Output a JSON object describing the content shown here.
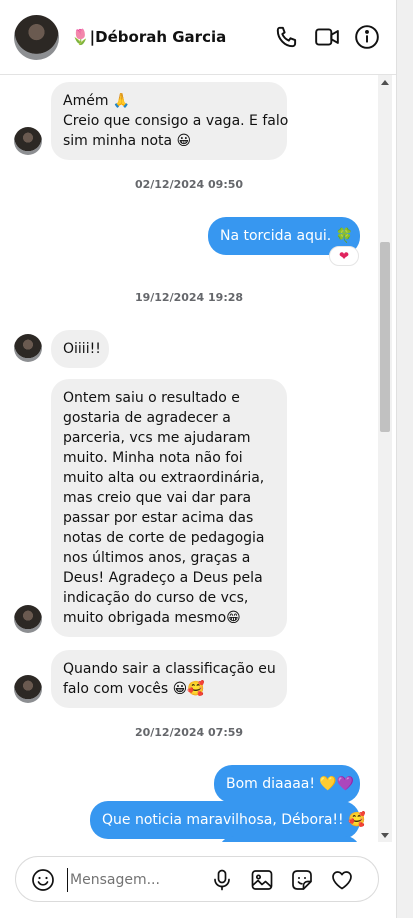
{
  "header": {
    "contact_name": "🌷|Déborah Garcia",
    "icons": [
      "phone-icon",
      "video-camera-icon",
      "info-icon"
    ]
  },
  "messages": [
    {
      "type": "incoming",
      "lines": [
        "Amém 🙏",
        "Creio que consigo a vaga. E falo",
        "sim minha nota 😀"
      ]
    },
    {
      "type": "timestamp",
      "text": "02/12/2024 09:50"
    },
    {
      "type": "outgoing",
      "text": "Na torcida aqui. 🍀",
      "reaction": "❤"
    },
    {
      "type": "timestamp",
      "text": "19/12/2024 19:28"
    },
    {
      "type": "incoming",
      "lines": [
        "Oiiii!!"
      ]
    },
    {
      "type": "incoming",
      "lines": [
        "Ontem saiu o resultado e",
        "gostaria de agradecer a",
        "parceria, vcs me ajudaram",
        "muito. Minha nota não foi",
        "muito alta ou extraordinária,",
        "mas creio que vai dar para",
        "passar por estar acima das",
        "notas de corte de pedagogia",
        "nos últimos anos, graças a",
        "Deus! Agradeço a Deus pela",
        "indicação do curso de vcs,",
        "muito obrigada mesmo😁"
      ]
    },
    {
      "type": "incoming",
      "lines": [
        "Quando sair a classificação eu",
        "falo com vocês 😀🥰"
      ]
    },
    {
      "type": "timestamp",
      "text": "20/12/2024 07:59"
    },
    {
      "type": "outgoing",
      "text": "Bom diaaaa! 💛💜"
    },
    {
      "type": "outgoing",
      "text": "Que noticia maravilhosa, Débora!! 🥰"
    }
  ],
  "composer": {
    "placeholder": "Mensagem...",
    "icons": [
      "emoji-icon",
      "microphone-icon",
      "image-icon",
      "sticker-icon",
      "heart-icon"
    ]
  },
  "colors": {
    "outgoing_bubble": "#3797f0",
    "incoming_bubble": "#efefef",
    "timestamp_text": "#65676b"
  }
}
